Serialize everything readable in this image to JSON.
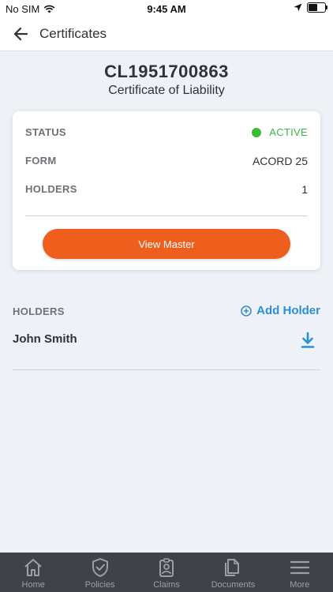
{
  "status_bar": {
    "carrier": "No SIM",
    "time": "9:45 AM",
    "battery_level": 0.6
  },
  "header": {
    "title": "Certificates"
  },
  "certificate": {
    "id": "CL1951700863",
    "type": "Certificate of Liability"
  },
  "details": {
    "status_label": "STATUS",
    "status_value": "ACTIVE",
    "status_color": "#3cbd2f",
    "form_label": "FORM",
    "form_value": "ACORD 25",
    "holders_label": "HOLDERS",
    "holders_value": "1"
  },
  "view_master_label": "View Master",
  "holders_section": {
    "label": "HOLDERS",
    "add_label": "Add Holder",
    "items": [
      {
        "name": "John Smith"
      }
    ]
  },
  "tabs": [
    {
      "label": "Home",
      "icon": "home-icon"
    },
    {
      "label": "Policies",
      "icon": "shield-icon"
    },
    {
      "label": "Claims",
      "icon": "badge-icon"
    },
    {
      "label": "Documents",
      "icon": "documents-icon"
    },
    {
      "label": "More",
      "icon": "menu-icon"
    }
  ],
  "colors": {
    "accent": "#ee5f1e",
    "link": "#2b8fd8",
    "tabbar": "#3f4347"
  }
}
